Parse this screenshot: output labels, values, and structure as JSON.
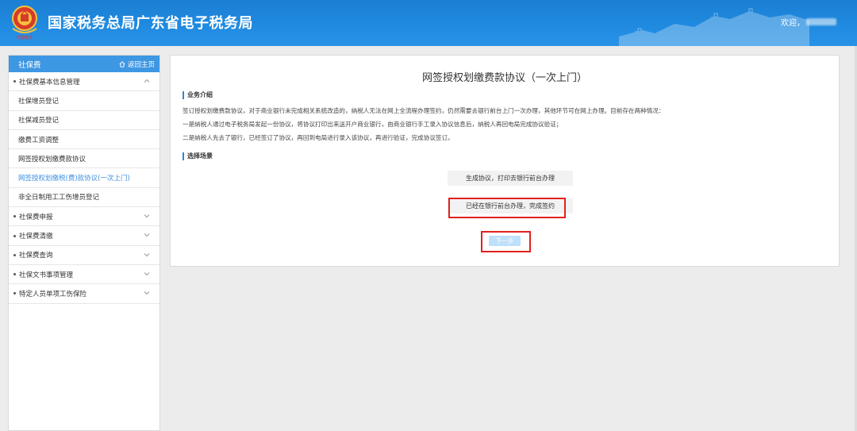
{
  "header": {
    "title": "国家税务总局广东省电子税务局",
    "welcome": "欢迎，",
    "emblem_caption": "中国税务"
  },
  "sidebar": {
    "title": "社保费",
    "home_link": "返回主页",
    "groups": [
      {
        "label": "社保费基本信息管理",
        "expanded": true,
        "items": [
          {
            "label": "社保增员登记"
          },
          {
            "label": "社保减员登记"
          },
          {
            "label": "缴费工资调整"
          },
          {
            "label": "网签授权划缴费款协议"
          },
          {
            "label": "网签授权划缴税(费)款协议(一次上门)",
            "active": true
          },
          {
            "label": "非全日制用工工伤增员登记"
          }
        ]
      },
      {
        "label": "社保费申报"
      },
      {
        "label": "社保费清缴"
      },
      {
        "label": "社保费查询"
      },
      {
        "label": "社保文书事项管理"
      },
      {
        "label": "特定人员单项工伤保险"
      }
    ]
  },
  "main": {
    "title": "网签授权划缴费款协议（一次上门）",
    "intro_label": "业务介绍",
    "intro_lines": [
      "签订授权划缴费款协议，对于商业银行未完成相关系统改造的，纳税人无法在网上全流程办理签约，仍然需要去银行前台上门一次办理，其他环节可在网上办理。目前存在两种情况：",
      "一是纳税人通过电子税务局发起一份协议，将协议打印出来送开户商业银行，由商业银行手工录入协议信息后，纳税人再回电局完成协议验证；",
      "二是纳税人先去了银行，已经签订了协议，再回到电局进行录入该协议，再进行验证，完成协议签订。"
    ],
    "scene_label": "选择场景",
    "options": [
      "生成协议，打印去银行前台办理",
      "已经在银行前台办理，完成签约"
    ],
    "next_button": "下一步"
  },
  "colors": {
    "header_blue": "#1f8ae0",
    "sidebar_head": "#3d97e3",
    "active_link": "#3f8fe0",
    "highlight_red": "#e0211e",
    "next_button": "#bfe0fb"
  }
}
